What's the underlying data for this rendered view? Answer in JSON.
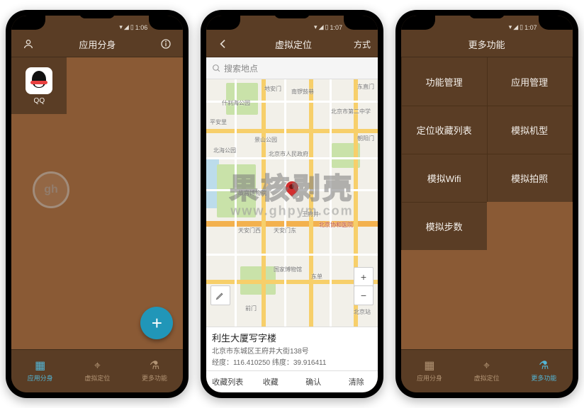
{
  "status": {
    "time": "1:06",
    "time2": "1:07",
    "time3": "1:07"
  },
  "screen1": {
    "title": "应用分身",
    "app_label": "QQ"
  },
  "bottomnav": {
    "items": [
      {
        "icon": "▦",
        "label": "应用分身"
      },
      {
        "icon": "⌖",
        "label": "虚拟定位"
      },
      {
        "icon": "⚗",
        "label": "更多功能"
      }
    ]
  },
  "screen2": {
    "title": "虚拟定位",
    "right": "方式",
    "search_placeholder": "搜索地点",
    "location_name": "利生大厦写字楼",
    "location_addr": "北京市东城区王府井大街138号",
    "location_coord": "经度：116.410250 纬度：39.916411",
    "actions": [
      "收藏列表",
      "收藏",
      "确认",
      "清除"
    ],
    "map_labels": [
      "地安门",
      "南锣鼓巷",
      "东直门",
      "什刹海公园",
      "景山公园",
      "北京市人民政府",
      "北京站",
      "天安门西",
      "天安门东",
      "故宫博物院",
      "王府井",
      "东单",
      "前门",
      "北京协和医院",
      "朝阳门",
      "国家博物馆",
      "北海公园",
      "北京市第二中学",
      "平安里"
    ]
  },
  "screen3": {
    "title": "更多功能",
    "cells": [
      "功能管理",
      "应用管理",
      "定位收藏列表",
      "模拟机型",
      "模拟Wifi",
      "模拟拍照",
      "模拟步数"
    ]
  },
  "watermark": {
    "big": "果核剥壳",
    "small": "www.ghpym.com",
    "circle": "gh"
  }
}
